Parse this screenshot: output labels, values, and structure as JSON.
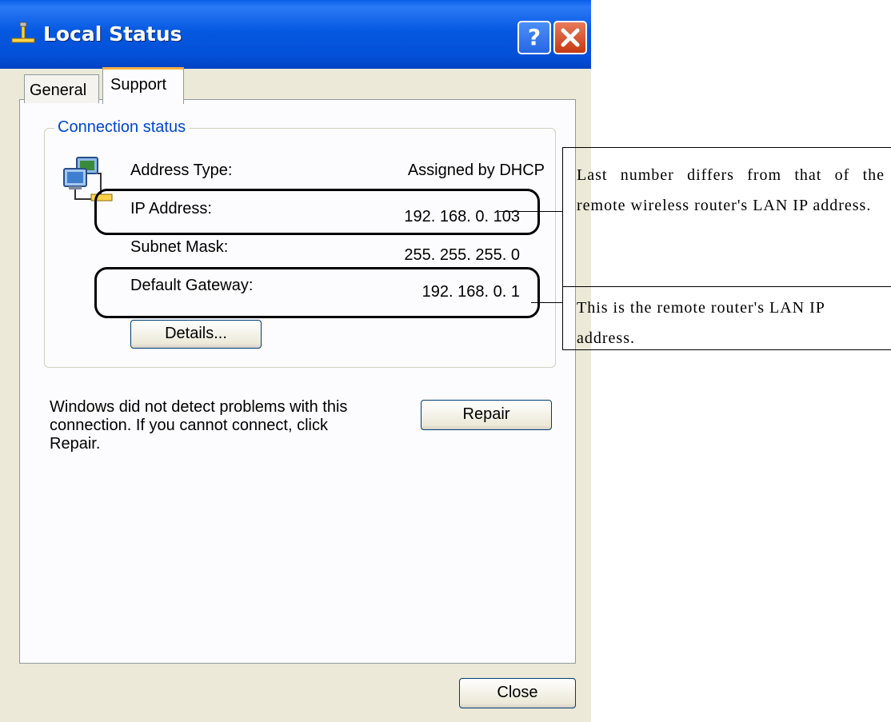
{
  "window": {
    "title": "Local Status",
    "help_label": "?",
    "icons": {
      "app": "network-connection-icon",
      "close": "close-icon",
      "connection": "network-computers-icon"
    }
  },
  "tabs": [
    {
      "label": "General",
      "active": false
    },
    {
      "label": "Support",
      "active": true
    }
  ],
  "connection_status": {
    "group_label": "Connection status",
    "rows": [
      {
        "label": "Address Type:",
        "value": "Assigned by DHCP"
      },
      {
        "label": "IP Address:",
        "value": "192. 168. 0. 103"
      },
      {
        "label": "Subnet Mask:",
        "value": "255. 255. 255. 0"
      },
      {
        "label": "Default Gateway:",
        "value": "192. 168. 0. 1"
      }
    ],
    "details_button": "Details..."
  },
  "repair": {
    "message": "Windows did not detect problems with this connection. If you cannot connect, click Repair.",
    "button": "Repair"
  },
  "close_button": "Close",
  "callouts": {
    "ip": "Last number differs from that of the remote wireless router's LAN IP address.",
    "gateway": "This is the remote router's LAN IP address."
  },
  "colors": {
    "titlebar": "#0558e1",
    "window_bg": "#ece9d8",
    "group_label": "#0046d5",
    "active_tab_accent": "#f7b343",
    "close_button": "#c43a13"
  }
}
